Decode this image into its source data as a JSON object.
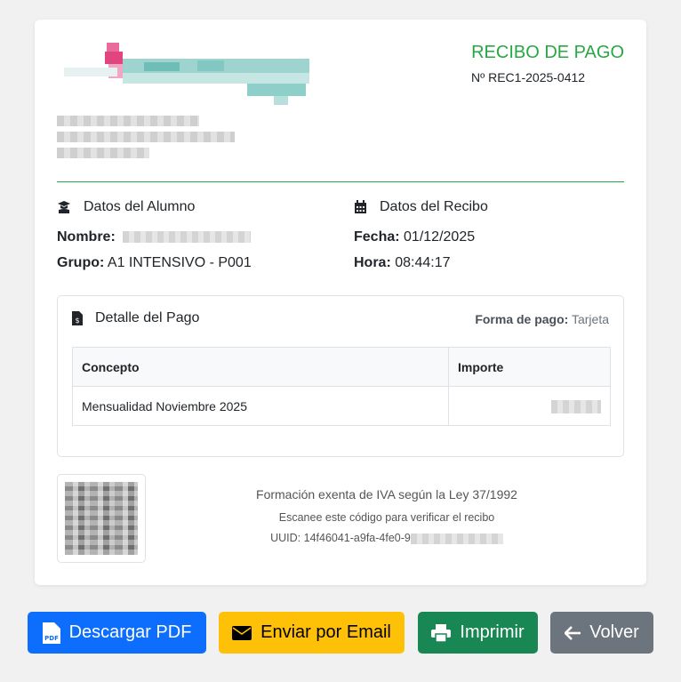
{
  "receipt": {
    "title": "RECIBO DE PAGO",
    "number": "Nº REC1-2025-0412"
  },
  "student": {
    "heading": "Datos del Alumno",
    "name_label": "Nombre:",
    "group_label": "Grupo:",
    "group_value": "A1 INTENSIVO - P001"
  },
  "receipt_data": {
    "heading": "Datos del Recibo",
    "date_label": "Fecha:",
    "date_value": "01/12/2025",
    "time_label": "Hora:",
    "time_value": "08:44:17"
  },
  "payment": {
    "heading": "Detalle del Pago",
    "method_label": "Forma de pago:",
    "method_value": "Tarjeta",
    "columns": [
      "Concepto",
      "Importe"
    ],
    "rows": [
      {
        "concept": "Mensualidad Noviembre 2025"
      }
    ]
  },
  "footer": {
    "vat_note": "Formación exenta de IVA según la Ley 37/1992",
    "scan_note": "Escanee este código para verificar el recibo",
    "uuid": "UUID: 14f46041-a9fa-4fe0-9"
  },
  "buttons": {
    "pdf": "Descargar PDF",
    "email": "Enviar por Email",
    "print": "Imprimir",
    "back": "Volver"
  },
  "colors": {
    "accent": "#28a745",
    "primary": "#0d6efd",
    "warning": "#ffc107",
    "success": "#198754",
    "secondary": "#6c757d"
  },
  "icons": [
    "graduate-icon",
    "calendar-icon",
    "invoice-icon",
    "file-pdf-icon",
    "envelope-icon",
    "printer-icon",
    "arrow-left-icon"
  ]
}
